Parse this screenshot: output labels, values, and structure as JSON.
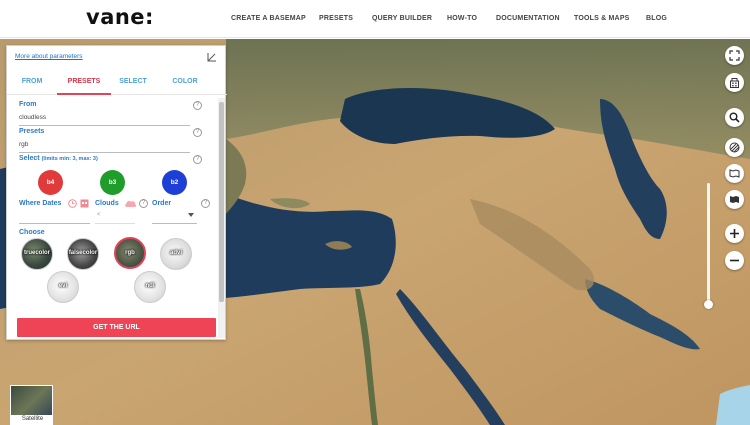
{
  "app": {
    "logo": "vane:"
  },
  "nav": [
    {
      "label": "CREATE A BASEMAP"
    },
    {
      "label": "PRESETS"
    },
    {
      "label": "QUERY BUILDER"
    },
    {
      "label": "HOW-TO"
    },
    {
      "label": "DOCUMENTATION"
    },
    {
      "label": "TOOLS & MAPS"
    },
    {
      "label": "BLOG"
    }
  ],
  "panel": {
    "link": "More about parameters",
    "tabs": [
      {
        "label": "FROM",
        "active": false
      },
      {
        "label": "PRESETS",
        "active": true
      },
      {
        "label": "SELECT",
        "active": false
      },
      {
        "label": "COLOR",
        "active": false
      }
    ],
    "from": {
      "label": "From",
      "value": "cloudless"
    },
    "presets": {
      "label": "Presets",
      "value": "rgb"
    },
    "select": {
      "label": "Select",
      "hint": "(limits min: 3, max: 3)",
      "bands": [
        {
          "label": "b4",
          "color": "#e03a3a"
        },
        {
          "label": "b3",
          "color": "#1f9d2a"
        },
        {
          "label": "b2",
          "color": "#1d3fd6"
        }
      ]
    },
    "where_dates": {
      "label": "Where Dates"
    },
    "clouds": {
      "label": "Clouds",
      "value": "<"
    },
    "order": {
      "label": "Order"
    },
    "choose": {
      "label": "Choose",
      "options": [
        {
          "label": "truecolor",
          "selected": false
        },
        {
          "label": "falsecolor",
          "selected": false
        },
        {
          "label": "rgb",
          "selected": true
        },
        {
          "label": "advi",
          "selected": false
        },
        {
          "label": "evi",
          "selected": false
        },
        {
          "label": "ndi",
          "selected": false
        }
      ]
    },
    "get_url": "GET THE URL"
  },
  "basemap": {
    "label": "Satellite"
  },
  "colors": {
    "accent": "#ef4456",
    "link": "#2a79c4",
    "active_tab": "#d9344a"
  },
  "icons": [
    "collapse-icon",
    "fullscreen-icon",
    "building-icon",
    "search-icon",
    "layers-icon",
    "map-icon",
    "map-fill-icon",
    "zoom-in-icon",
    "zoom-out-icon",
    "clock-icon",
    "calendar-icon",
    "cloud-icon",
    "help-icon"
  ]
}
